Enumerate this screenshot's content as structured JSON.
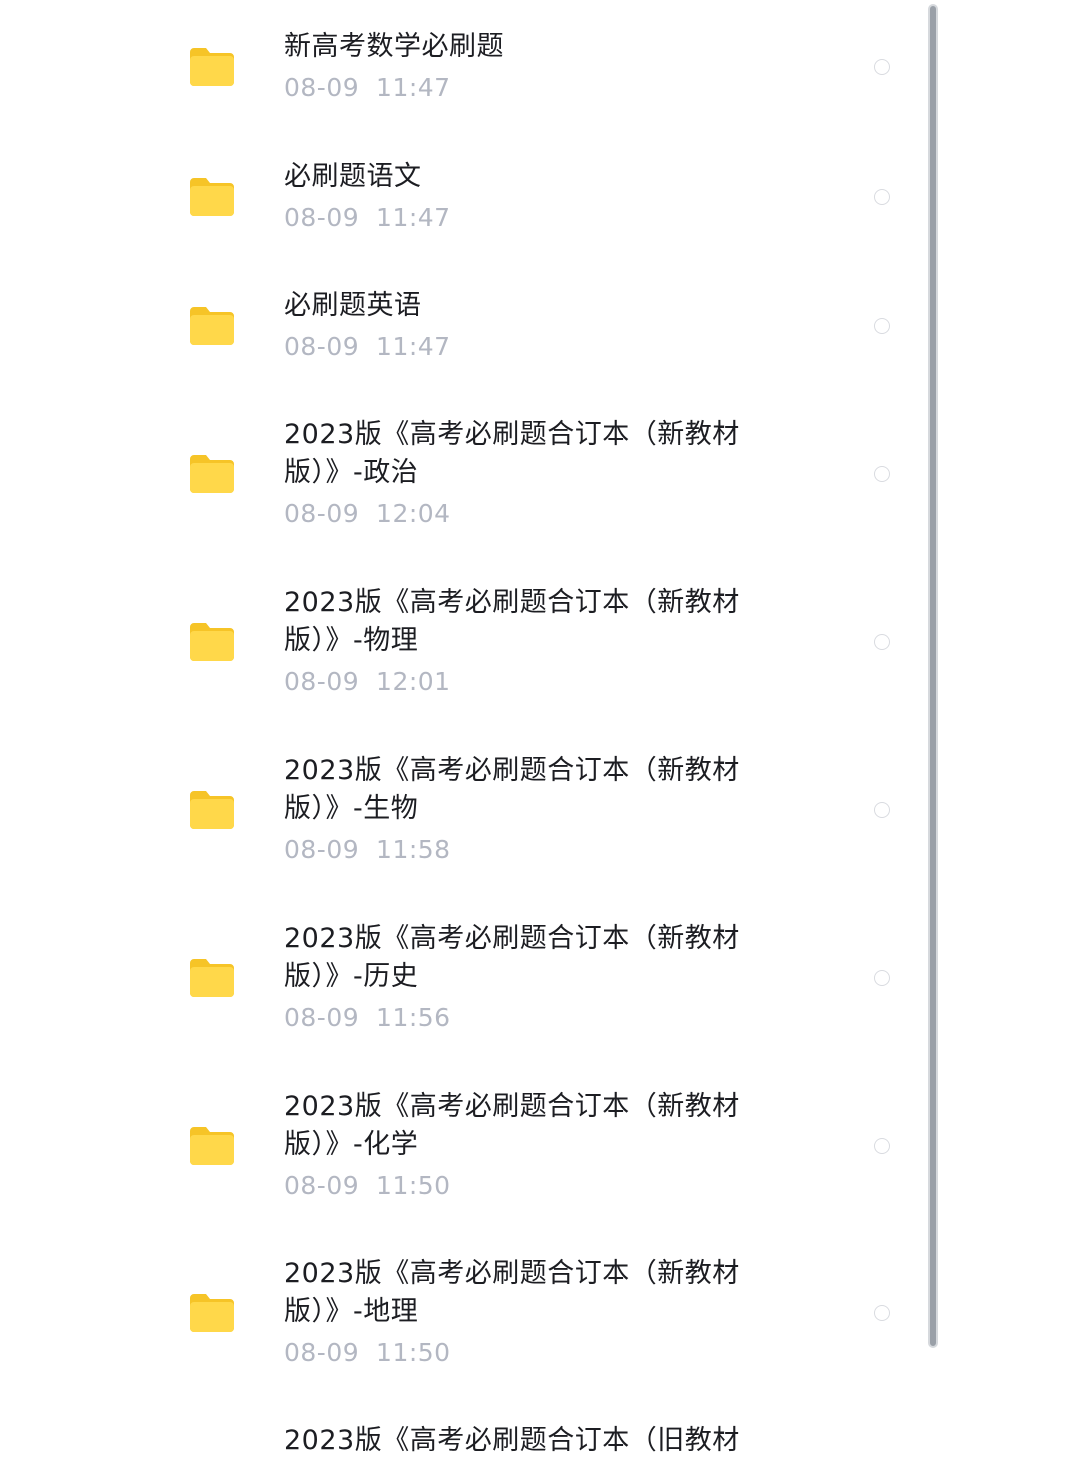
{
  "files": [
    {
      "name": "新高考数学必刷题",
      "date": "08-09  11:47"
    },
    {
      "name": "必刷题语文",
      "date": "08-09  11:47"
    },
    {
      "name": "必刷题英语",
      "date": "08-09  11:47"
    },
    {
      "name": "2023版《高考必刷题合订本（新教材版）》-政治",
      "date": "08-09  12:04"
    },
    {
      "name": "2023版《高考必刷题合订本（新教材版）》-物理",
      "date": "08-09  12:01"
    },
    {
      "name": "2023版《高考必刷题合订本（新教材版）》-生物",
      "date": "08-09  11:58"
    },
    {
      "name": "2023版《高考必刷题合订本（新教材版）》-历史",
      "date": "08-09  11:56"
    },
    {
      "name": "2023版《高考必刷题合订本（新教材版）》-化学",
      "date": "08-09  11:50"
    },
    {
      "name": "2023版《高考必刷题合订本（新教材版）》-地理",
      "date": "08-09  11:50"
    },
    {
      "name": "2023版《高考必刷题合订本（旧教材",
      "date": ""
    }
  ],
  "icons": {
    "folder": "folder-icon",
    "select": "radio-circle"
  },
  "colors": {
    "folder_yellow": "#FFD33D",
    "title_text": "#1c1d22",
    "date_text": "#b3b7c2"
  }
}
